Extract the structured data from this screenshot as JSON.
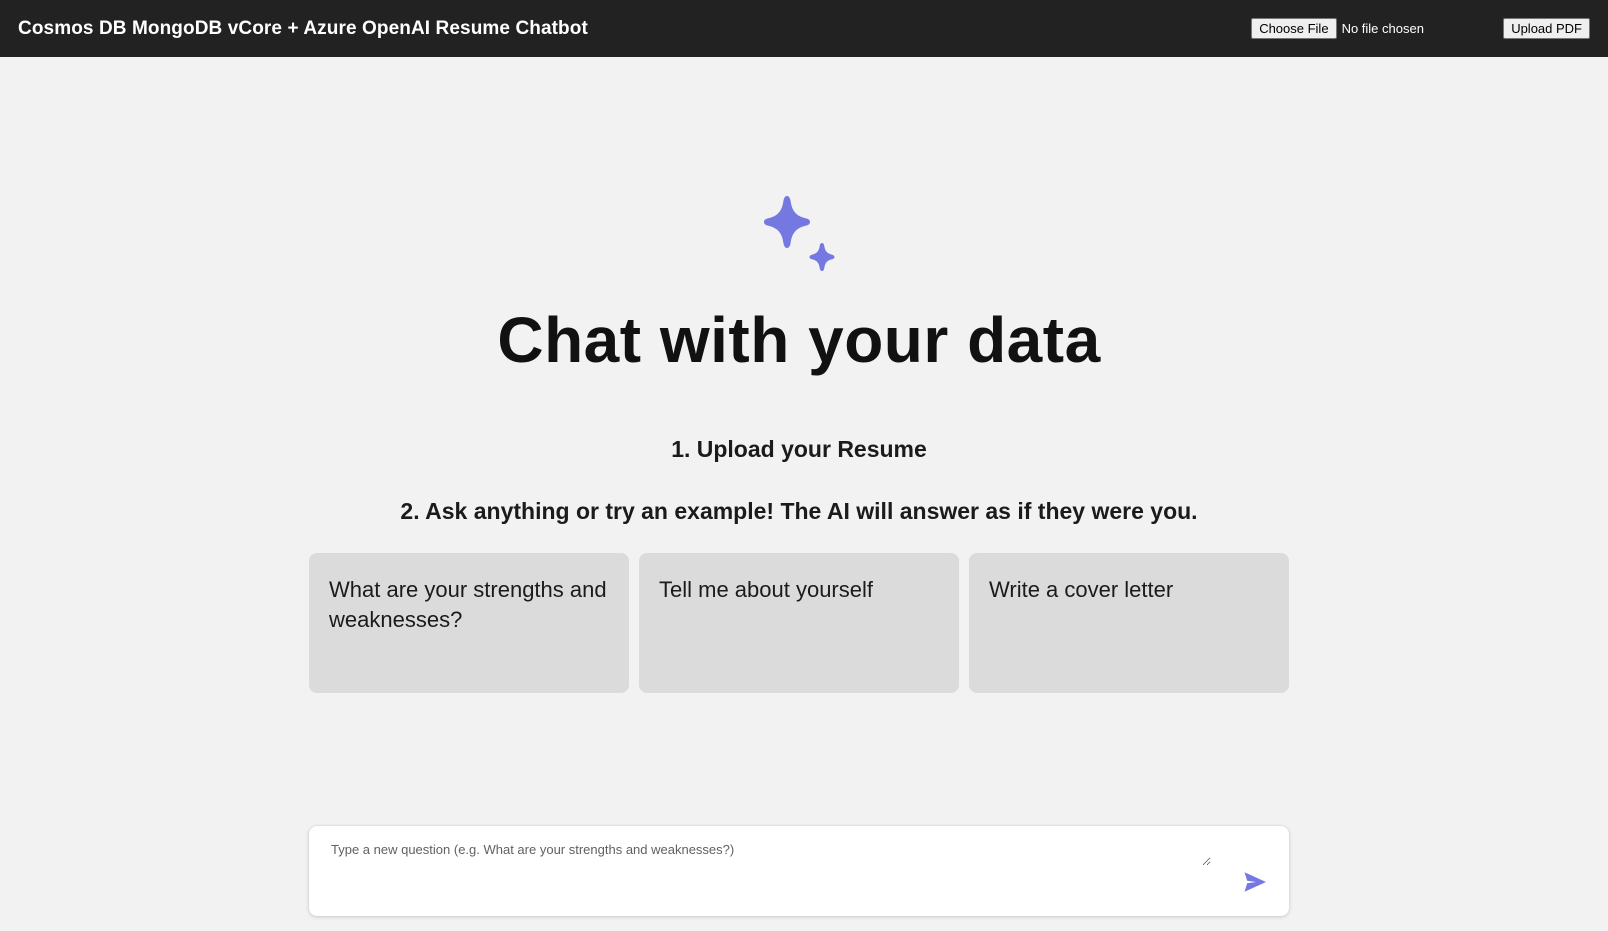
{
  "header": {
    "title": "Cosmos DB MongoDB vCore + Azure OpenAI Resume Chatbot",
    "choose_file_label": "Choose File",
    "file_status": "No file chosen",
    "upload_label": "Upload PDF"
  },
  "hero": {
    "icon": "sparkle-icon",
    "title": "Chat with your data",
    "step1": "1. Upload your Resume",
    "step2": "2. Ask anything or try an example! The AI will answer as if they were you."
  },
  "examples": [
    {
      "label": "What are your strengths and weaknesses?"
    },
    {
      "label": "Tell me about yourself"
    },
    {
      "label": "Write a cover letter"
    }
  ],
  "question": {
    "placeholder": "Type a new question (e.g. What are your strengths and weaknesses?)",
    "send_icon": "send-icon"
  },
  "colors": {
    "accent": "#7478e0",
    "header_bg": "#222222",
    "page_bg": "#f2f2f2",
    "card_bg": "#dbdbdb"
  }
}
